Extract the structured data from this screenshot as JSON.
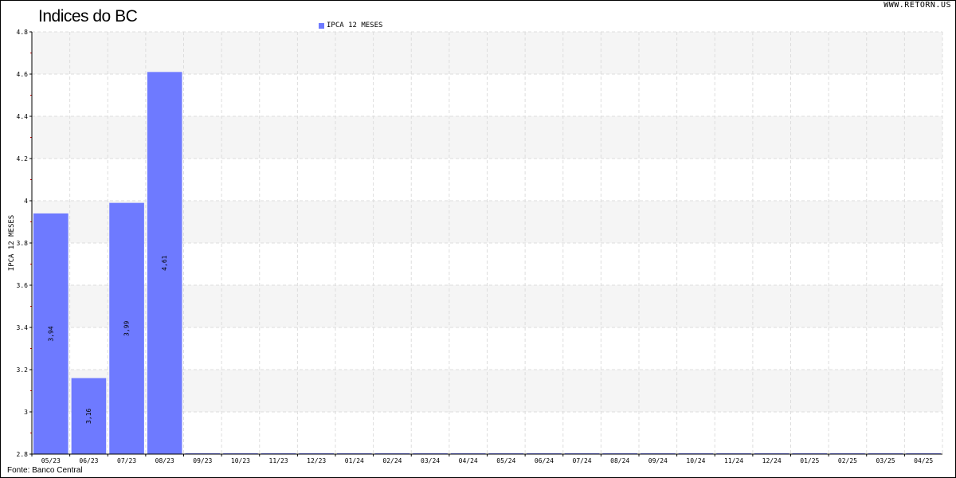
{
  "header": {
    "title": "Indices do BC",
    "watermark": "WWW.RETORN.US"
  },
  "footer": {
    "source": "Fonte: Banco Central"
  },
  "chart_data": {
    "type": "bar",
    "title": "Indices do BC",
    "xlabel": "",
    "ylabel": "IPCA 12 MESES",
    "ylim": [
      2.8,
      4.8
    ],
    "yticks": [
      2.8,
      3,
      3.2,
      3.4,
      3.6,
      3.8,
      4,
      4.2,
      4.4,
      4.6,
      4.8
    ],
    "ytick_labels": [
      "2.8",
      "3",
      "3.2",
      "3.4",
      "3.6",
      "3.8",
      "4",
      "4.2",
      "4.4",
      "4.6",
      "4.8"
    ],
    "categories": [
      "05/23",
      "06/23",
      "07/23",
      "08/23",
      "09/23",
      "10/23",
      "11/23",
      "12/23",
      "01/24",
      "02/24",
      "03/24",
      "04/24",
      "05/24",
      "06/24",
      "07/24",
      "08/24",
      "09/24",
      "10/24",
      "11/24",
      "12/24",
      "01/25",
      "02/25",
      "03/25",
      "04/25"
    ],
    "series": [
      {
        "name": "IPCA 12 MESES",
        "color": "#6e7aff",
        "values": [
          3.94,
          3.16,
          3.99,
          4.61,
          null,
          null,
          null,
          null,
          null,
          null,
          null,
          null,
          null,
          null,
          null,
          null,
          null,
          null,
          null,
          null,
          null,
          null,
          null,
          null
        ],
        "labels": [
          "3,94",
          "3,16",
          "3,99",
          "4,61"
        ]
      }
    ],
    "legend_position": "top-center",
    "grid": true
  }
}
